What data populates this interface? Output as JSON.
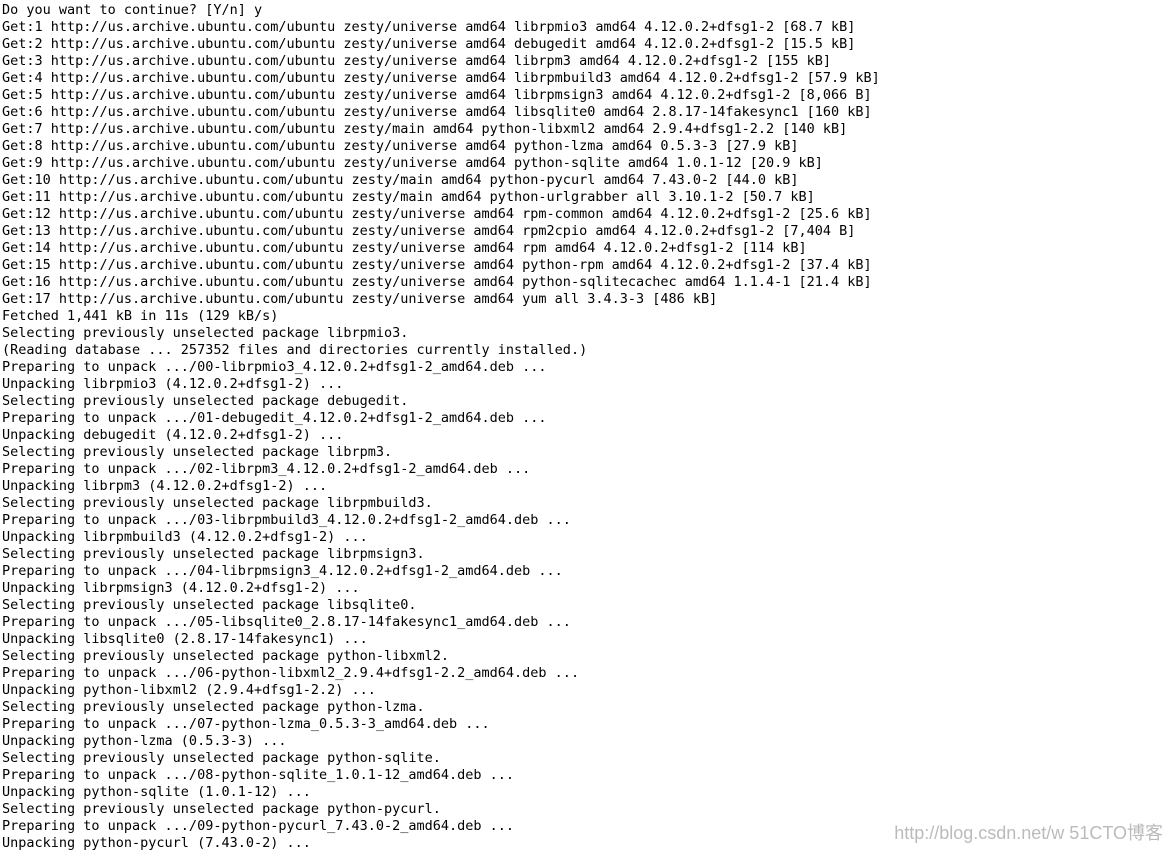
{
  "terminal": {
    "lines": [
      "Do you want to continue? [Y/n] y",
      "Get:1 http://us.archive.ubuntu.com/ubuntu zesty/universe amd64 librpmio3 amd64 4.12.0.2+dfsg1-2 [68.7 kB]",
      "Get:2 http://us.archive.ubuntu.com/ubuntu zesty/universe amd64 debugedit amd64 4.12.0.2+dfsg1-2 [15.5 kB]",
      "Get:3 http://us.archive.ubuntu.com/ubuntu zesty/universe amd64 librpm3 amd64 4.12.0.2+dfsg1-2 [155 kB]",
      "Get:4 http://us.archive.ubuntu.com/ubuntu zesty/universe amd64 librpmbuild3 amd64 4.12.0.2+dfsg1-2 [57.9 kB]",
      "Get:5 http://us.archive.ubuntu.com/ubuntu zesty/universe amd64 librpmsign3 amd64 4.12.0.2+dfsg1-2 [8,066 B]",
      "Get:6 http://us.archive.ubuntu.com/ubuntu zesty/universe amd64 libsqlite0 amd64 2.8.17-14fakesync1 [160 kB]",
      "Get:7 http://us.archive.ubuntu.com/ubuntu zesty/main amd64 python-libxml2 amd64 2.9.4+dfsg1-2.2 [140 kB]",
      "Get:8 http://us.archive.ubuntu.com/ubuntu zesty/universe amd64 python-lzma amd64 0.5.3-3 [27.9 kB]",
      "Get:9 http://us.archive.ubuntu.com/ubuntu zesty/universe amd64 python-sqlite amd64 1.0.1-12 [20.9 kB]",
      "Get:10 http://us.archive.ubuntu.com/ubuntu zesty/main amd64 python-pycurl amd64 7.43.0-2 [44.0 kB]",
      "Get:11 http://us.archive.ubuntu.com/ubuntu zesty/main amd64 python-urlgrabber all 3.10.1-2 [50.7 kB]",
      "Get:12 http://us.archive.ubuntu.com/ubuntu zesty/universe amd64 rpm-common amd64 4.12.0.2+dfsg1-2 [25.6 kB]",
      "Get:13 http://us.archive.ubuntu.com/ubuntu zesty/universe amd64 rpm2cpio amd64 4.12.0.2+dfsg1-2 [7,404 B]",
      "Get:14 http://us.archive.ubuntu.com/ubuntu zesty/universe amd64 rpm amd64 4.12.0.2+dfsg1-2 [114 kB]",
      "Get:15 http://us.archive.ubuntu.com/ubuntu zesty/universe amd64 python-rpm amd64 4.12.0.2+dfsg1-2 [37.4 kB]",
      "Get:16 http://us.archive.ubuntu.com/ubuntu zesty/universe amd64 python-sqlitecachec amd64 1.1.4-1 [21.4 kB]",
      "Get:17 http://us.archive.ubuntu.com/ubuntu zesty/universe amd64 yum all 3.4.3-3 [486 kB]",
      "Fetched 1,441 kB in 11s (129 kB/s)",
      "Selecting previously unselected package librpmio3.",
      "(Reading database ... 257352 files and directories currently installed.)",
      "Preparing to unpack .../00-librpmio3_4.12.0.2+dfsg1-2_amd64.deb ...",
      "Unpacking librpmio3 (4.12.0.2+dfsg1-2) ...",
      "Selecting previously unselected package debugedit.",
      "Preparing to unpack .../01-debugedit_4.12.0.2+dfsg1-2_amd64.deb ...",
      "Unpacking debugedit (4.12.0.2+dfsg1-2) ...",
      "Selecting previously unselected package librpm3.",
      "Preparing to unpack .../02-librpm3_4.12.0.2+dfsg1-2_amd64.deb ...",
      "Unpacking librpm3 (4.12.0.2+dfsg1-2) ...",
      "Selecting previously unselected package librpmbuild3.",
      "Preparing to unpack .../03-librpmbuild3_4.12.0.2+dfsg1-2_amd64.deb ...",
      "Unpacking librpmbuild3 (4.12.0.2+dfsg1-2) ...",
      "Selecting previously unselected package librpmsign3.",
      "Preparing to unpack .../04-librpmsign3_4.12.0.2+dfsg1-2_amd64.deb ...",
      "Unpacking librpmsign3 (4.12.0.2+dfsg1-2) ...",
      "Selecting previously unselected package libsqlite0.",
      "Preparing to unpack .../05-libsqlite0_2.8.17-14fakesync1_amd64.deb ...",
      "Unpacking libsqlite0 (2.8.17-14fakesync1) ...",
      "Selecting previously unselected package python-libxml2.",
      "Preparing to unpack .../06-python-libxml2_2.9.4+dfsg1-2.2_amd64.deb ...",
      "Unpacking python-libxml2 (2.9.4+dfsg1-2.2) ...",
      "Selecting previously unselected package python-lzma.",
      "Preparing to unpack .../07-python-lzma_0.5.3-3_amd64.deb ...",
      "Unpacking python-lzma (0.5.3-3) ...",
      "Selecting previously unselected package python-sqlite.",
      "Preparing to unpack .../08-python-sqlite_1.0.1-12_amd64.deb ...",
      "Unpacking python-sqlite (1.0.1-12) ...",
      "Selecting previously unselected package python-pycurl.",
      "Preparing to unpack .../09-python-pycurl_7.43.0-2_amd64.deb ...",
      "Unpacking python-pycurl (7.43.0-2) ..."
    ]
  },
  "watermark": {
    "text": "http://blog.csdn.net/w   51CTO博客"
  }
}
